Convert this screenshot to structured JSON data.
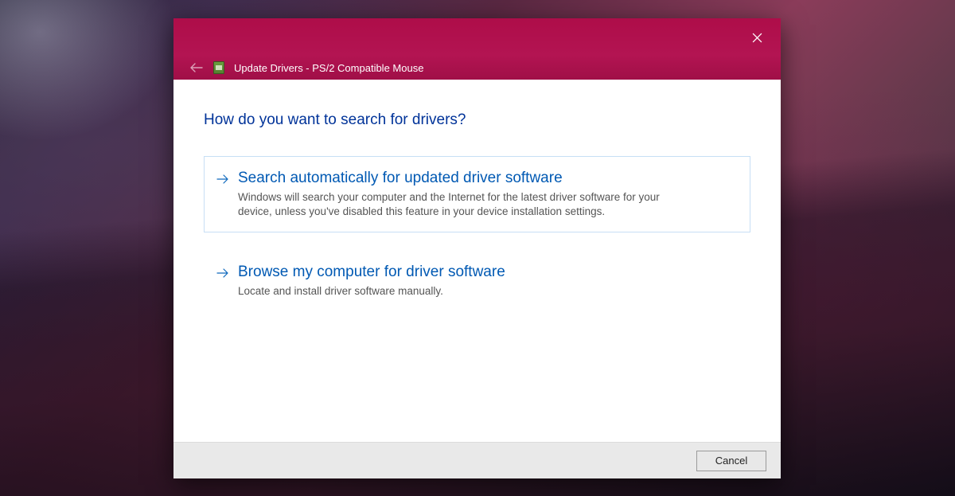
{
  "titlebar": {
    "back_enabled": false,
    "title": "Update Drivers - PS/2 Compatible Mouse"
  },
  "body": {
    "prompt": "How do you want to search for drivers?",
    "options": [
      {
        "title": "Search automatically for updated driver software",
        "description": "Windows will search your computer and the Internet for the latest driver software for your device, unless you've disabled this feature in your device installation settings."
      },
      {
        "title": "Browse my computer for driver software",
        "description": "Locate and install driver software manually."
      }
    ]
  },
  "footer": {
    "cancel_label": "Cancel"
  }
}
